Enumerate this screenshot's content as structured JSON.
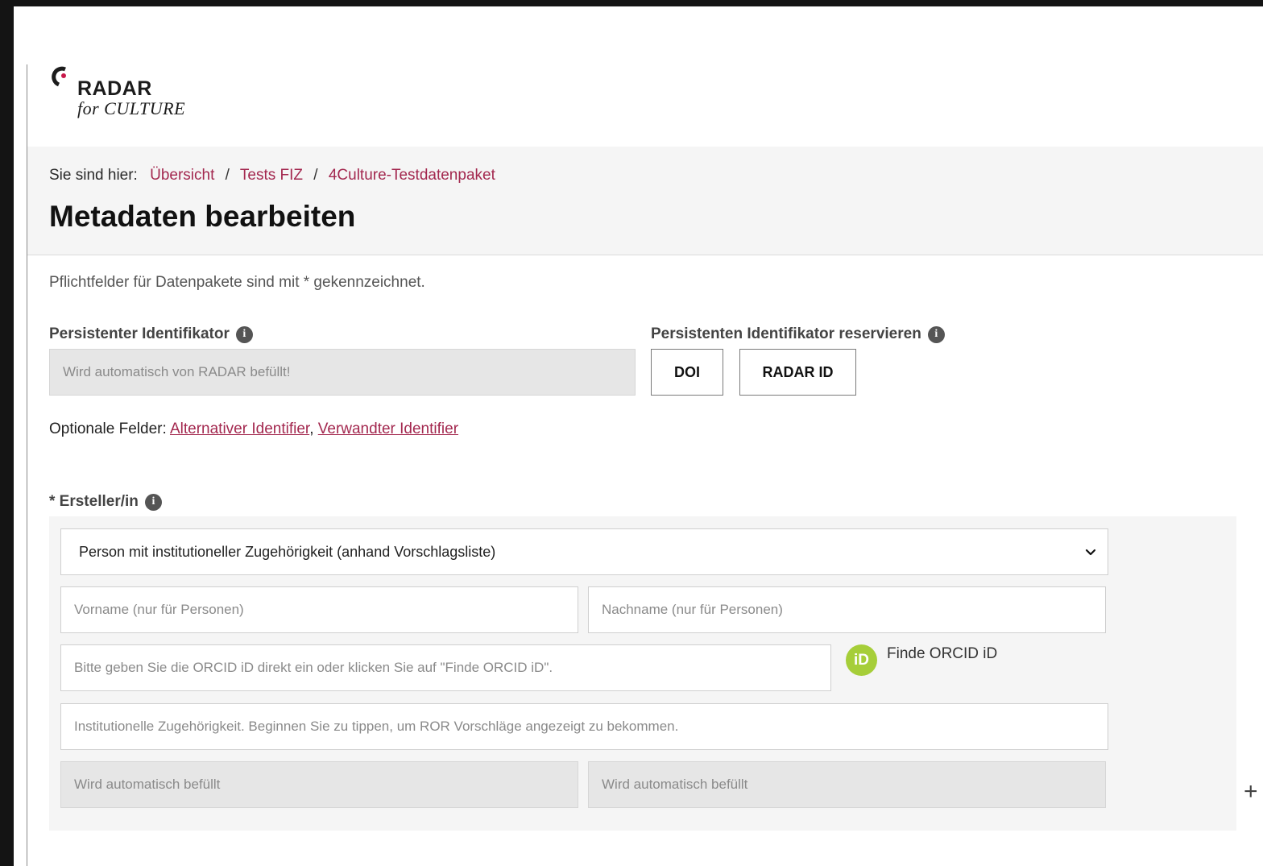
{
  "logo": {
    "name": "RADAR",
    "subtitle": "for CULTURE"
  },
  "breadcrumb": {
    "lead": "Sie sind hier:",
    "items": [
      "Übersicht",
      "Tests FIZ",
      "4Culture-Testdatenpaket"
    ],
    "separator": "/"
  },
  "page_title": "Metadaten bearbeiten",
  "required_note": "Pflichtfelder für Datenpakete sind mit * gekennzeichnet.",
  "identifier": {
    "label": "Persistenter Identifikator",
    "placeholder": "Wird automatisch von RADAR befüllt!",
    "reserve_label": "Persistenten Identifikator reservieren",
    "buttons": [
      "DOI",
      "RADAR ID"
    ]
  },
  "optional_fields": {
    "lead": "Optionale Felder:",
    "links": [
      "Alternativer Identifier",
      "Verwandter Identifier"
    ],
    "joiner": ", "
  },
  "creator": {
    "label": "* Ersteller/in",
    "type_selected": "Person mit institutioneller Zugehörigkeit (anhand Vorschlagsliste)",
    "firstname_placeholder": "Vorname (nur für Personen)",
    "lastname_placeholder": "Nachname (nur für Personen)",
    "orcid_placeholder": "Bitte geben Sie die ORCID iD direkt ein oder klicken Sie auf \"Finde ORCID iD\".",
    "orcid_button": "Finde ORCID iD",
    "orcid_badge": "iD",
    "affiliation_placeholder": "Institutionelle Zugehörigkeit. Beginnen Sie zu tippen, um ROR Vorschläge angezeigt zu bekommen.",
    "auto1_placeholder": "Wird automatisch befüllt",
    "auto2_placeholder": "Wird automatisch befüllt",
    "add_symbol": "+"
  },
  "info_icon": "i",
  "icons": [
    "info-icon",
    "chevron-down-icon",
    "orcid-icon",
    "plus-icon",
    "radar-logo-mark"
  ],
  "colors": {
    "link": "#a3284f",
    "orcid": "#a6ce39",
    "logo_dot": "#c8194b"
  }
}
